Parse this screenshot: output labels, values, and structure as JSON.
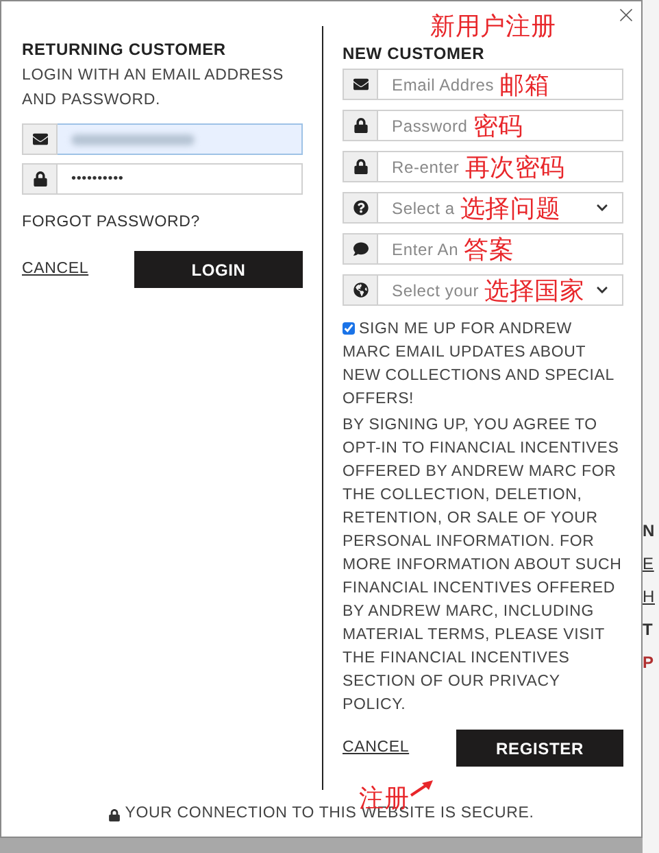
{
  "returning_customer": {
    "title": "RETURNING CUSTOMER",
    "instructions": "LOGIN WITH AN EMAIL ADDRESS AND PASSWORD.",
    "fields": [
      {
        "kind": "email",
        "focused": true,
        "blurred": true
      },
      {
        "kind": "password",
        "focused": false,
        "value": "••••••••••"
      }
    ],
    "forgot_link": "FORGOT PASSWORD?",
    "cancel": "CANCEL",
    "login": "LOGIN"
  },
  "new_customer": {
    "title": "NEW CUSTOMER",
    "fields": [
      {
        "kind": "email",
        "placeholder": "Email Addres",
        "dropdown": false
      },
      {
        "kind": "password",
        "placeholder": "Password",
        "dropdown": false
      },
      {
        "kind": "password",
        "placeholder": "Re-enter",
        "dropdown": false
      },
      {
        "kind": "question",
        "placeholder": "Select a",
        "dropdown": true
      },
      {
        "kind": "answer",
        "placeholder": "Enter An",
        "dropdown": false
      },
      {
        "kind": "country",
        "placeholder": "Select your",
        "dropdown": true
      }
    ],
    "signup": {
      "checked": true,
      "label": "SIGN ME UP FOR ANDREW MARC EMAIL UPDATES ABOUT NEW COLLECTIONS AND SPECIAL OFFERS!"
    },
    "disclosure": "BY SIGNING UP, YOU AGREE TO OPT-IN TO FINANCIAL INCENTIVES OFFERED BY ANDREW MARC FOR THE COLLECTION, DELETION, RETENTION, OR SALE OF YOUR PERSONAL INFORMATION. FOR MORE INFORMATION ABOUT SUCH FINANCIAL INCENTIVES OFFERED BY ANDREW MARC, INCLUDING MATERIAL TERMS, PLEASE VISIT THE FINANCIAL INCENTIVES SECTION OF OUR PRIVACY POLICY.",
    "cancel": "CANCEL",
    "register": "REGISTER"
  },
  "secure_note": "YOUR CONNECTION TO THIS WEBSITE IS SECURE.",
  "annotations": [
    {
      "text": "新用户注册",
      "arrow": false
    },
    {
      "text": "邮箱",
      "arrow": false
    },
    {
      "text": "密码",
      "arrow": false
    },
    {
      "text": "再次密码",
      "arrow": false
    },
    {
      "text": "选择问题",
      "arrow": false
    },
    {
      "text": "答案",
      "arrow": false
    },
    {
      "text": "选择国家",
      "arrow": false
    },
    {
      "text": "注册",
      "arrow": true
    }
  ],
  "background_fragments": [
    {
      "text": "N",
      "kind": "plain"
    },
    {
      "text": "E",
      "kind": "link"
    },
    {
      "text": "H",
      "kind": "link"
    },
    {
      "text": "T",
      "kind": "plain"
    },
    {
      "text": "P",
      "kind": "alert"
    }
  ]
}
